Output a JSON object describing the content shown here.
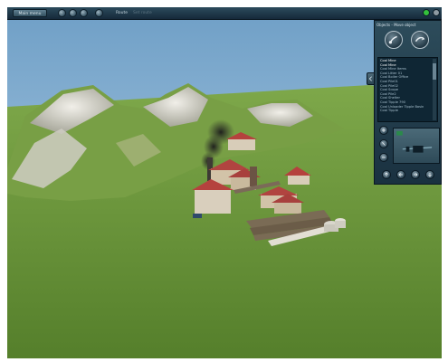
{
  "toolbar": {
    "main_menu_label": "Main menu",
    "route_label": "Route",
    "route_sublabel": "Set route"
  },
  "panel": {
    "header": "Objects - Move object",
    "list_title": "Coal Mine",
    "objects": [
      "Coal Mine",
      "Coal Mine Items",
      "Coal Litter 01",
      "Coal Boiler Office",
      "Coal Pile01",
      "Coal Pile02",
      "Coal Scope",
      "Coal Pile2",
      "Coal Shelter",
      "Coal Tipple 790",
      "Coal Unloader Tipple Basin",
      "Coal Tipple"
    ],
    "selected_index": 0
  },
  "icons": {
    "toolbar": [
      "gear-icon",
      "arrow-icon",
      "undo-icon",
      "camera-icon",
      "status-green-light",
      "status-gray-light"
    ],
    "panel": [
      "brush-icon",
      "object-icon",
      "plus-icon",
      "rotate-icon",
      "minus-icon",
      "collapse-arrow-icon",
      "nav-icons"
    ]
  },
  "colors": {
    "toolbar": "#1f3a4b",
    "panel": "#24414f",
    "sky": "#8fb9d8",
    "grass": "#6f9b3c",
    "roof": "#b5423e",
    "status_green": "#34c13c"
  }
}
